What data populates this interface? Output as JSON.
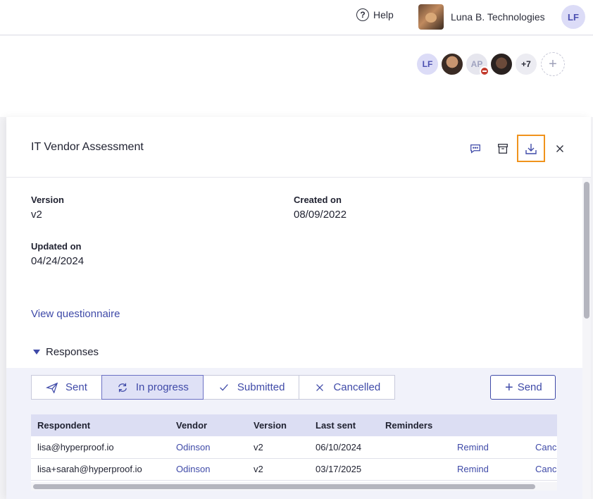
{
  "header": {
    "help_label": "Help",
    "org_name": "Luna B. Technologies",
    "user_initials": "LF"
  },
  "collaborators": {
    "items": [
      {
        "initials": "LF"
      },
      {
        "initials": ""
      },
      {
        "initials": "AP"
      },
      {
        "initials": ""
      },
      {
        "initials": "+7"
      }
    ],
    "add_label": "+"
  },
  "panel": {
    "title": "IT Vendor Assessment",
    "fields": {
      "version_label": "Version",
      "version_value": "v2",
      "created_label": "Created on",
      "created_value": "08/09/2022",
      "updated_label": "Updated on",
      "updated_value": "04/24/2024"
    },
    "view_questionnaire": "View questionnaire",
    "responses_label": "Responses"
  },
  "filters": {
    "sent": "Sent",
    "in_progress": "In progress",
    "submitted": "Submitted",
    "cancelled": "Cancelled",
    "active": "In progress"
  },
  "send_button": "Send",
  "table": {
    "columns": [
      "Respondent",
      "Vendor",
      "Version",
      "Last sent",
      "Reminders",
      "",
      ""
    ],
    "rows": [
      {
        "respondent": "lisa@hyperproof.io",
        "vendor": "Odinson",
        "version": "v2",
        "last_sent": "06/10/2024",
        "reminders": "",
        "remind": "Remind",
        "cancel": "Canc"
      },
      {
        "respondent": "lisa+sarah@hyperproof.io",
        "vendor": "Odinson",
        "version": "v2",
        "last_sent": "03/17/2025",
        "reminders": "",
        "remind": "Remind",
        "cancel": "Canc"
      }
    ]
  },
  "colors": {
    "accent": "#3f4aa8",
    "highlight": "#f0931c",
    "active_filter_bg": "#dfe1f6"
  }
}
